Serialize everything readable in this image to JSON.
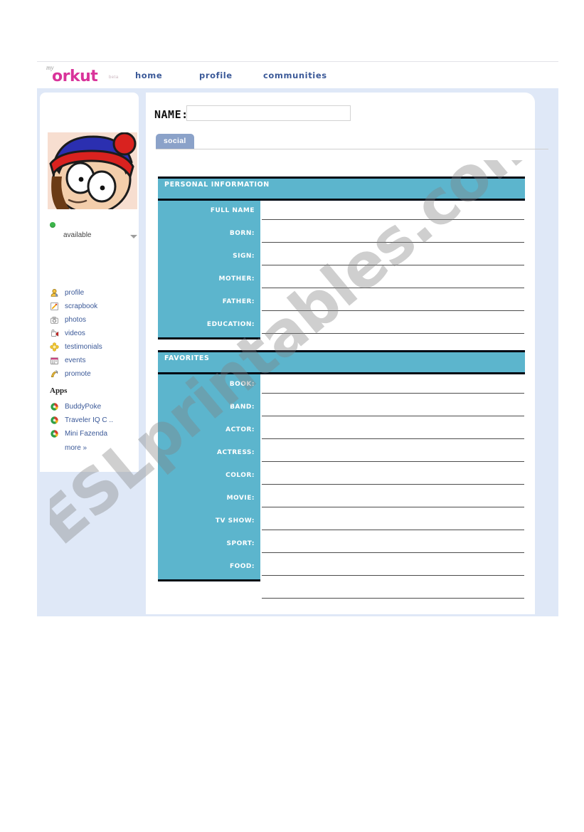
{
  "header": {
    "logo_my": "my",
    "logo_name": "orkut",
    "logo_beta": "beta",
    "nav": [
      {
        "label": "home",
        "name": "nav-home"
      },
      {
        "label": "profile",
        "name": "nav-profile"
      },
      {
        "label": "communities",
        "name": "nav-communities"
      }
    ]
  },
  "sidebar": {
    "status": {
      "label": "available",
      "dot_color": "#3cb54a"
    },
    "nav_items": [
      {
        "label": "profile",
        "icon": "person-icon"
      },
      {
        "label": "scrapbook",
        "icon": "notepad-pencil-icon"
      },
      {
        "label": "photos",
        "icon": "camera-icon"
      },
      {
        "label": "videos",
        "icon": "video-camera-icon"
      },
      {
        "label": "testimonials",
        "icon": "flower-star-icon"
      },
      {
        "label": "events",
        "icon": "calendar-icon"
      },
      {
        "label": "promote",
        "icon": "megaphone-icon"
      }
    ],
    "apps_title": "Apps",
    "apps": [
      {
        "label": "BuddyPoke",
        "icon": "app-ball-icon"
      },
      {
        "label": "Traveler IQ C ..",
        "icon": "app-ball-icon"
      },
      {
        "label": "Mini Fazenda",
        "icon": "app-ball-icon"
      }
    ],
    "more_label": "more »"
  },
  "main": {
    "name_label": "NAME:",
    "name_value": "",
    "name_placeholder": "",
    "tabs": [
      {
        "label": "social",
        "active": true
      }
    ],
    "sections": [
      {
        "title": "PERSONAL INFORMATION",
        "fields": [
          "FULL NAME",
          "BORN:",
          "SIGN:",
          "MOTHER:",
          "FATHER:",
          "EDUCATION:"
        ]
      },
      {
        "title": "FAVORITES",
        "fields": [
          "BOOK:",
          "BAND:",
          "ACTOR:",
          "ACTRESS:",
          "COLOR:",
          "MOVIE:",
          "TV SHOW:",
          "SPORT:",
          "FOOD:"
        ]
      }
    ]
  },
  "watermark": {
    "text": "ESLprintables.com"
  },
  "colors": {
    "teal": "#5cb5cd",
    "tab_blue": "#8ba2c9",
    "link_blue": "#3b5998",
    "backdrop": "#dfe8f7",
    "logo_pink": "#d9339a",
    "rule_black": "#000814"
  }
}
